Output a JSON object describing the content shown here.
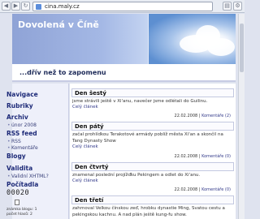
{
  "browser": {
    "url": "cina.maly.cz"
  },
  "site": {
    "title": "Dovolená v Číně",
    "tagline": "...dřív než to zapomenu"
  },
  "sidebar": {
    "nav": "Navigace",
    "rubriky": "Rubriky",
    "archiv": "Archiv",
    "archiv_item": "únor 2008",
    "rss": "RSS feed",
    "rss_items": [
      "RSS",
      "Komentáře"
    ],
    "blogy": "Blogy",
    "validita": "Validita",
    "validita_item": "Validní XHTML?",
    "pocitadlo": "Počítadla",
    "counter": "00020",
    "stats": [
      "známka blogu: 1",
      "počet hlasů: 2"
    ]
  },
  "posts": [
    {
      "title": "Den šestý",
      "text": "jsme strávili ještě v Xi'anu, navečer jsme odlétali do Guilinu.",
      "link": "Celý článek",
      "date": "22.02.2008",
      "comments": "Komentáře (2)"
    },
    {
      "title": "Den pátý",
      "text": "začal prohlídkou Terakotové armády poblíž města Xi'an a skončil na Tang Dynasty Show",
      "link": "Celý článek",
      "date": "22.02.2008",
      "comments": "Komentáře (0)"
    },
    {
      "title": "Den čtvrtý",
      "text": "znamenal poslední projížďku Pekingem a odlet do Xi'anu.",
      "link": "Celý článek",
      "date": "22.02.2008",
      "comments": "Komentáře (0)"
    },
    {
      "title": "Den třetí",
      "text": "zahrnoval Velkou čínskou zeď, hrobku dynastie Ming, Svatou cestu a pekingskou kachnu. A nad plán ještě kung-fu show.",
      "link": "",
      "date": "",
      "comments": ""
    }
  ]
}
